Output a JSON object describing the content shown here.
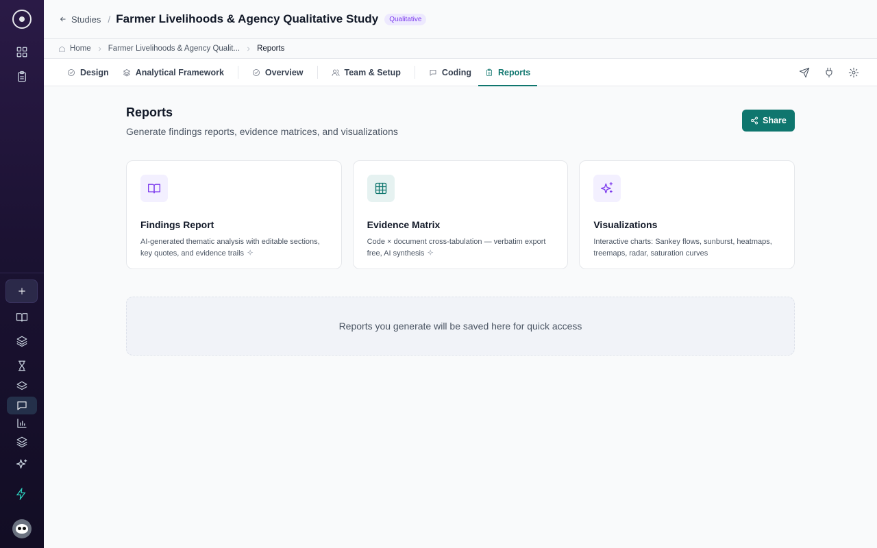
{
  "header": {
    "back_label": "Studies",
    "separator": "/",
    "study_title": "Farmer Livelihoods & Agency Qualitative Study",
    "badge": "Qualitative"
  },
  "breadcrumb": {
    "home": "Home",
    "study": "Farmer Livelihoods & Agency Qualit...",
    "current": "Reports"
  },
  "tabs": [
    {
      "label": "Design",
      "icon": "check-circle-icon"
    },
    {
      "label": "Analytical Framework",
      "icon": "layers-icon"
    },
    {
      "label": "Overview",
      "icon": "check-circle-icon"
    },
    {
      "label": "Team & Setup",
      "icon": "users-icon"
    },
    {
      "label": "Coding",
      "icon": "message-icon"
    },
    {
      "label": "Reports",
      "icon": "clipboard-icon",
      "active": true
    }
  ],
  "toolbar": {
    "icons": [
      "send-icon",
      "plug-icon",
      "gear-icon"
    ]
  },
  "page": {
    "title": "Reports",
    "subtitle": "Generate findings reports, evidence matrices, and visualizations",
    "share_label": "Share"
  },
  "cards": [
    {
      "title": "Findings Report",
      "description": "AI-generated thematic analysis with editable sections, key quotes, and evidence trails",
      "icon": "book-icon"
    },
    {
      "title": "Evidence Matrix",
      "description": "Code × document cross-tabulation — verbatim export free, AI synthesis",
      "icon": "grid-icon"
    },
    {
      "title": "Visualizations",
      "description": "Interactive charts: Sankey flows, sunburst, heatmaps, treemaps, radar, saturation curves",
      "icon": "sparkles-icon"
    }
  ],
  "empty_state": {
    "message": "Reports you generate will be saved here for quick access"
  },
  "colors": {
    "accent": "#0f766e",
    "badge_bg": "#ede9fe",
    "badge_text": "#7c3aed",
    "rail_top": "#2a1a46",
    "rail_bottom": "#120d24"
  }
}
